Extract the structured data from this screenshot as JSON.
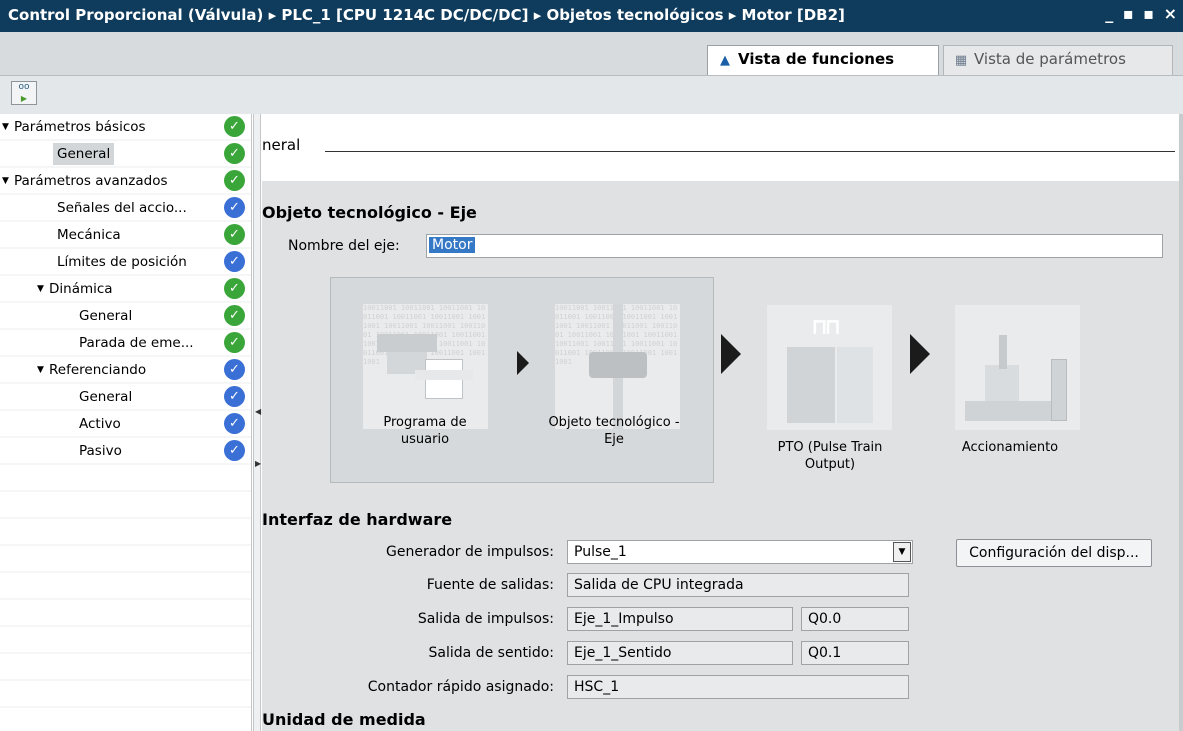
{
  "window": {
    "breadcrumb": "Control Proporcional (Válvula) ▸ PLC_1 [CPU 1214C DC/DC/DC] ▸ Objetos tecnológicos ▸ Motor [DB2]",
    "controls": "_ ▪ ▪ ×"
  },
  "view_tabs": [
    {
      "label": "Vista de funciones",
      "icon": "motion-object-icon",
      "active": true
    },
    {
      "label": "Vista de parámetros",
      "icon": "table-icon",
      "active": false
    }
  ],
  "nav": {
    "items": [
      {
        "label": "Parámetros básicos",
        "status": "green"
      },
      {
        "label": "General",
        "status": "green"
      },
      {
        "label": "Parámetros avanzados",
        "status": "green"
      },
      {
        "label": "Señales del accio...",
        "status": "blue"
      },
      {
        "label": "Mecánica",
        "status": "green"
      },
      {
        "label": "Límites de posición",
        "status": "blue"
      },
      {
        "label": "Dinámica",
        "status": "green"
      },
      {
        "label": "General",
        "status": "green"
      },
      {
        "label": "Parada de eme...",
        "status": "green"
      },
      {
        "label": "Referenciando",
        "status": "blue"
      },
      {
        "label": "General",
        "status": "blue"
      },
      {
        "label": "Activo",
        "status": "blue"
      },
      {
        "label": "Pasivo",
        "status": "blue"
      }
    ],
    "status_colors": {
      "green": "#3aa63a",
      "blue": "#3a6fd6"
    }
  },
  "section": {
    "header": "neral"
  },
  "tech_object": {
    "heading": "Objeto tecnológico - Eje",
    "axis_label": "Nombre del eje:",
    "axis_value": "Motor"
  },
  "diagram": {
    "captions": [
      "Programa de\nusuario",
      "Objeto tecnológico -\nEje",
      "PTO (Pulse Train\nOutput)",
      "Accionamiento"
    ]
  },
  "hardware": {
    "heading": "Interfaz de hardware",
    "pulse_gen_label": "Generador de impulsos:",
    "pulse_gen_value": "Pulse_1",
    "config_button": "Configuración del disp...",
    "output_source_label": "Fuente de salidas:",
    "output_source_value": "Salida de CPU integrada",
    "pulse_out_label": "Salida de impulsos:",
    "pulse_out_value": "Eje_1_Impulso",
    "pulse_out_addr": "Q0.0",
    "dir_out_label": "Salida de sentido:",
    "dir_out_value": "Eje_1_Sentido",
    "dir_out_addr": "Q0.1",
    "hsc_label": "Contador rápido asignado:",
    "hsc_value": "HSC_1"
  },
  "units": {
    "heading": "Unidad de medida"
  }
}
